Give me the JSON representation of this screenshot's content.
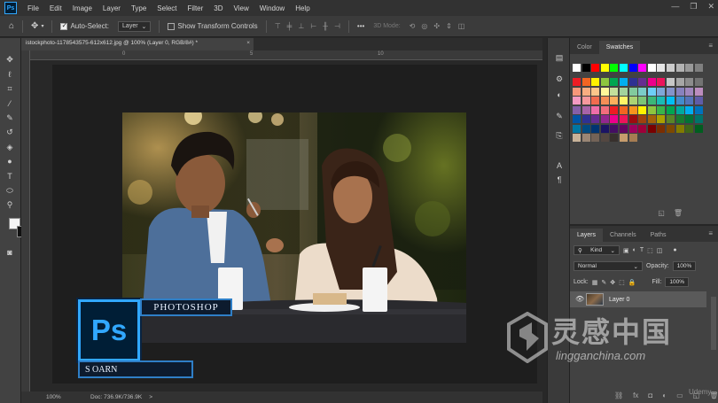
{
  "app": {
    "logo": "Ps"
  },
  "menu": [
    "File",
    "Edit",
    "Image",
    "Layer",
    "Type",
    "Select",
    "Filter",
    "3D",
    "View",
    "Window",
    "Help"
  ],
  "window_controls": {
    "minimize": "—",
    "restore": "❐",
    "close": "✕"
  },
  "options_bar": {
    "auto_select_label": "Auto-Select:",
    "auto_select_checked": true,
    "auto_select_target": "Layer",
    "transform_label": "Show Transform Controls",
    "transform_checked": false,
    "mode_3d_label": "3D Mode:"
  },
  "document_tab": {
    "title": "istockphoto-1178543575-612x612.jpg @ 100% (Layer 0, RGB/8#) *",
    "close": "×"
  },
  "ruler": {
    "top_marks": [
      "0",
      "5",
      "10"
    ]
  },
  "status_bar": {
    "zoom": "100%",
    "doc_info": "Doc: 736.9K/736.9K",
    "arrow": ">"
  },
  "swatches_panel": {
    "tabs": [
      "Color",
      "Swatches"
    ],
    "active_tab": "Swatches",
    "colors": [
      [
        "#ffffff",
        "#000000",
        "#ff0000",
        "#ffff00",
        "#00ff00",
        "#00ffff",
        "#0000ff",
        "#ff00ff",
        "#ffffff",
        "#e6e6e6",
        "#cccccc",
        "#b3b3b3",
        "#999999",
        "#808080"
      ],
      [
        "#ed1c24",
        "#f26522",
        "#fff200",
        "#8dc63f",
        "#00a651",
        "#00aeef",
        "#2e3192",
        "#662d91",
        "#ec008c",
        "#ed145b",
        "#c7c7c7",
        "#a6a6a6",
        "#8c8c8c",
        "#737373"
      ],
      [
        "#f7977a",
        "#f9ad81",
        "#fdc68a",
        "#fff79a",
        "#c4df9b",
        "#a3d39c",
        "#82ca9d",
        "#7bcdc8",
        "#6ecff6",
        "#7ea7d8",
        "#8493ca",
        "#8882be",
        "#a187be",
        "#bc8dbf"
      ],
      [
        "#f49ac2",
        "#f6989d",
        "#f26c4f",
        "#f68e56",
        "#fbaf5d",
        "#fff467",
        "#acd373",
        "#7cc576",
        "#3bb878",
        "#1abbb4",
        "#00bff3",
        "#438ccb",
        "#5574b9",
        "#605ca8"
      ],
      [
        "#855fa8",
        "#a763a8",
        "#f06ea9",
        "#f26d7d",
        "#ed1c24",
        "#f26522",
        "#f7941d",
        "#fff200",
        "#8dc63f",
        "#39b54a",
        "#00a651",
        "#00a99d",
        "#00aeef",
        "#0072bc"
      ],
      [
        "#0054a6",
        "#2e3192",
        "#662d91",
        "#92278f",
        "#ec008c",
        "#ed145b",
        "#9e0b0f",
        "#a0410d",
        "#a36209",
        "#aba000",
        "#598527",
        "#197b30",
        "#007236",
        "#00746b"
      ],
      [
        "#0076a3",
        "#004a80",
        "#003471",
        "#1b1464",
        "#440e62",
        "#630460",
        "#9e005d",
        "#9e0039",
        "#790000",
        "#7b2e00",
        "#7d4900",
        "#827b00",
        "#406618",
        "#005e20"
      ],
      [
        "#c7b299",
        "#998675",
        "#736357",
        "#534741",
        "#37302d",
        "#c69c6d",
        "#a67c52"
      ]
    ]
  },
  "layers_panel": {
    "tabs": [
      "Layers",
      "Channels",
      "Paths"
    ],
    "active_tab": "Layers",
    "filter_kind": "Kind",
    "blend_mode": "Normal",
    "opacity_label": "Opacity:",
    "opacity_value": "100%",
    "lock_label": "Lock:",
    "fill_label": "Fill:",
    "fill_value": "100%",
    "layer_name": "Layer 0"
  },
  "overlay": {
    "ps_badge": "Ps",
    "ps_label": "PHOTOSHOP",
    "ps_subtitle": "S OARN"
  },
  "watermark": {
    "chinese": "灵感中国",
    "domain": "lingganchina.com",
    "udemy": "Udemy"
  },
  "colors": {
    "accent": "#31a8ff",
    "panel_bg": "#424242",
    "workspace": "#1e1e1e"
  }
}
